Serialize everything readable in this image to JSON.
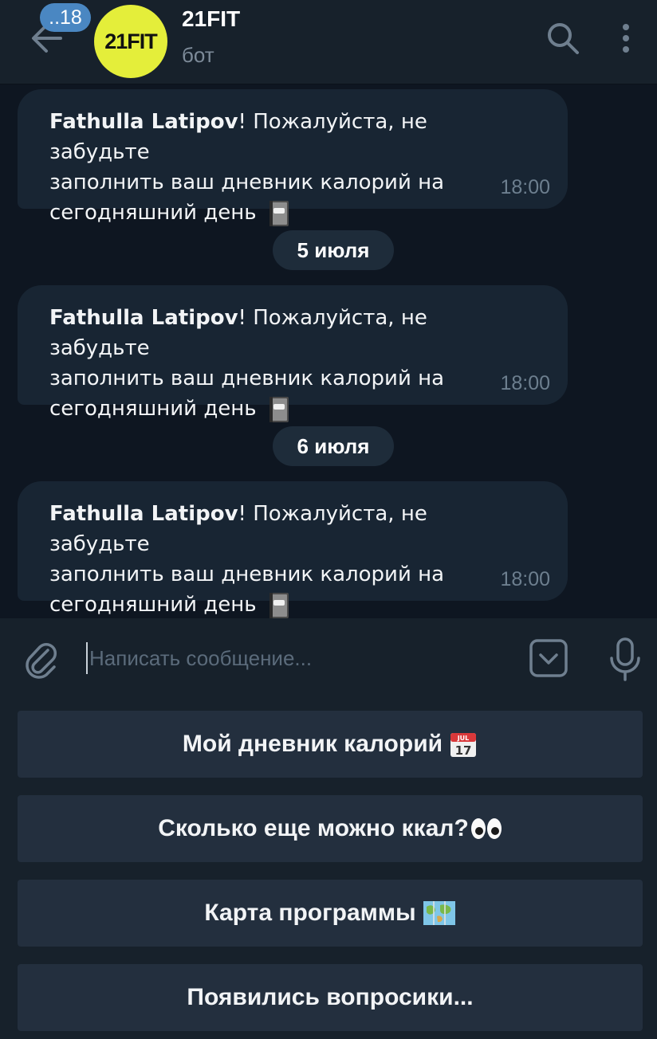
{
  "header": {
    "unread_count": "..18",
    "avatar_text": "21FIT",
    "title": "21FIT",
    "subtitle": "бот"
  },
  "messages": [
    {
      "sender": "Fathulla Latipov",
      "text_line1_rest": "! Пожалуйста, не забудьте",
      "text_line2": "заполнить ваш дневник калорий на",
      "text_line3": "сегодняшний день",
      "emoji": "notebook",
      "time": "18:00"
    },
    {
      "sender": "Fathulla Latipov",
      "text_line1_rest": "! Пожалуйста, не забудьте",
      "text_line2": "заполнить ваш дневник калорий на",
      "text_line3": "сегодняшний день",
      "emoji": "notebook",
      "time": "18:00"
    },
    {
      "sender": "Fathulla Latipov",
      "text_line1_rest": "! Пожалуйста, не забудьте",
      "text_line2": "заполнить ваш дневник калорий на",
      "text_line3": "сегодняшний день",
      "emoji": "notebook",
      "time": "18:00"
    }
  ],
  "date_separators": [
    "5 июля",
    "6 июля"
  ],
  "composer": {
    "placeholder": "Написать сообщение..."
  },
  "keyboard": {
    "buttons": [
      {
        "label": "Мой дневник калорий",
        "emoji": "calendar"
      },
      {
        "label": "Сколько еще можно ккал?",
        "emoji": "eyes"
      },
      {
        "label": "Карта программы",
        "emoji": "map"
      },
      {
        "label": "Появились вопросики..."
      }
    ],
    "calendar_month": "JUL",
    "calendar_day": "17"
  },
  "colors": {
    "background": "#0e1621",
    "header": "#17212b",
    "bubble": "#182533",
    "accent_badge": "#4a87c2",
    "avatar": "#e4ee3a",
    "keyboard_button": "#232f3e"
  }
}
